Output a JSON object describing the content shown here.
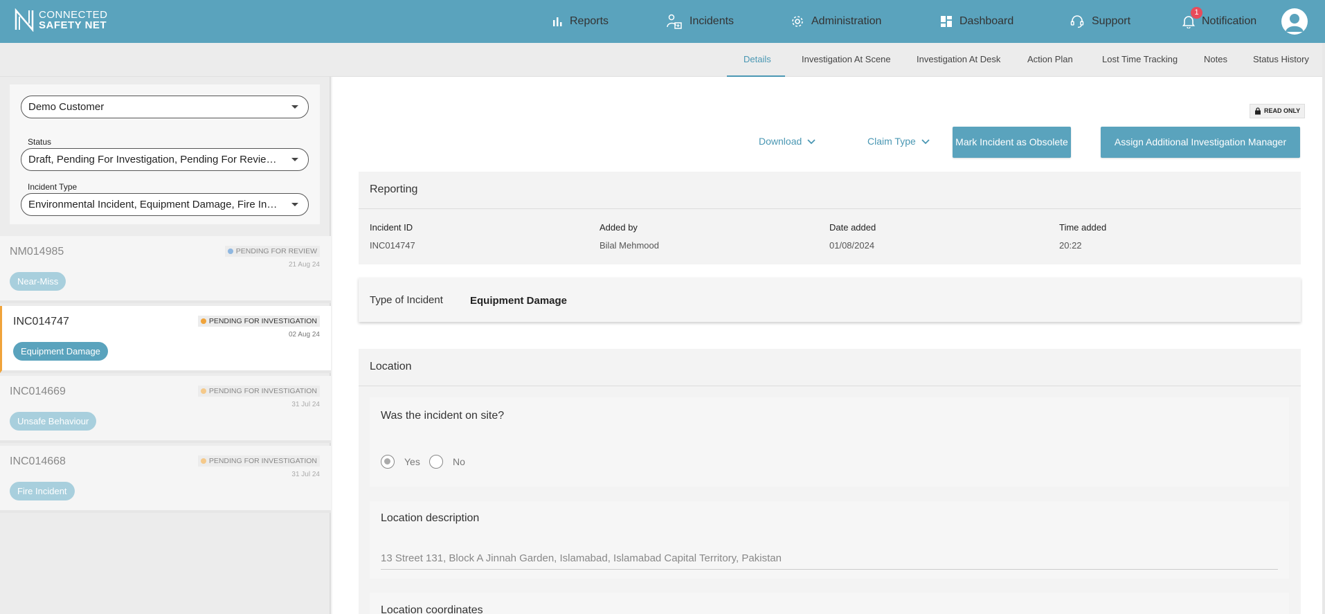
{
  "brand": {
    "line1": "CONNECTED",
    "line2": "SAFETY NET"
  },
  "nav": {
    "reports": "Reports",
    "incidents": "Incidents",
    "administration": "Administration",
    "dashboard": "Dashboard",
    "support": "Support",
    "notification": "Notification",
    "notification_count": "1"
  },
  "subtabs": {
    "details": "Details",
    "investigation_scene": "Investigation At Scene",
    "investigation_desk": "Investigation At Desk",
    "action_plan": "Action Plan",
    "lost_time": "Lost Time Tracking",
    "notes": "Notes",
    "status_history": "Status History"
  },
  "filters": {
    "customer": "Demo Customer",
    "status_label": "Status",
    "status_value": "Draft, Pending For Investigation, Pending For Review, ...",
    "type_label": "Incident Type",
    "type_value": "Environmental Incident, Equipment Damage, Fire Incid..."
  },
  "incidents": [
    {
      "id": "NM014985",
      "status": "PENDING FOR REVIEW",
      "status_color": "#8fb7e0",
      "date": "21 Aug 24",
      "tag": "Near-Miss"
    },
    {
      "id": "INC014747",
      "status": "PENDING FOR INVESTIGATION",
      "status_color": "#f0a33a",
      "date": "02 Aug 24",
      "tag": "Equipment Damage"
    },
    {
      "id": "INC014669",
      "status": "PENDING FOR INVESTIGATION",
      "status_color": "#f5c98a",
      "date": "31 Jul 24",
      "tag": "Unsafe Behaviour"
    },
    {
      "id": "INC014668",
      "status": "PENDING FOR INVESTIGATION",
      "status_color": "#f5c98a",
      "date": "31 Jul 24",
      "tag": "Fire Incident"
    }
  ],
  "toolbar": {
    "read_only": "READ ONLY",
    "download": "Download",
    "claim_type": "Claim Type",
    "mark_obsolete": "Mark Incident as Obsolete",
    "assign_manager": "Assign Additional Investigation Manager"
  },
  "reporting": {
    "title": "Reporting",
    "incident_id_label": "Incident ID",
    "incident_id": "INC014747",
    "added_by_label": "Added by",
    "added_by": "Bilal Mehmood",
    "date_added_label": "Date added",
    "date_added": "01/08/2024",
    "time_added_label": "Time added",
    "time_added": "20:22"
  },
  "type_of_incident": {
    "label": "Type of Incident",
    "value": "Equipment Damage"
  },
  "location": {
    "title": "Location",
    "on_site_question": "Was the incident on site?",
    "yes": "Yes",
    "no": "No",
    "selected": "Yes",
    "description_label": "Location description",
    "description_value": "13 Street 131, Block A Jinnah Garden, Islamabad, Islamabad Capital Territory, Pakistan",
    "coordinates_label": "Location coordinates"
  },
  "colors": {
    "primary": "#5aa3bd",
    "accent_link": "#4a97b3",
    "active_border": "#f0a33a",
    "badge": "#e94b5a"
  }
}
